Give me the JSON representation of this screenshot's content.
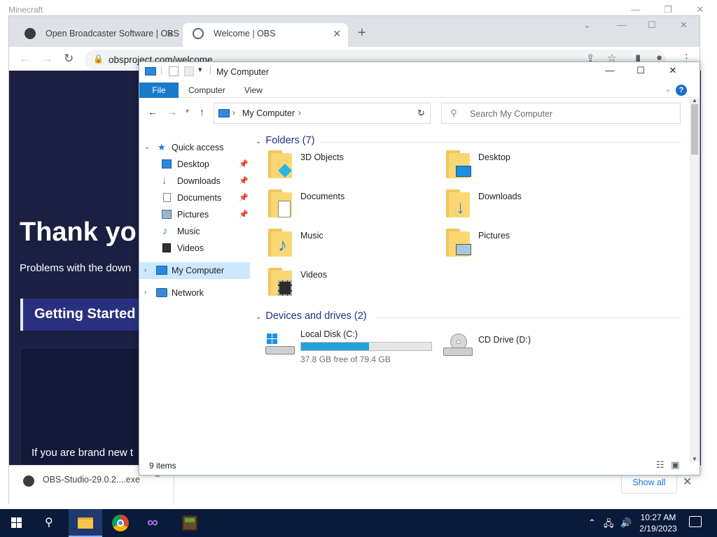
{
  "outer_window": {
    "title": "Minecraft"
  },
  "chrome": {
    "tabs": [
      {
        "label": "Open Broadcaster Software | OBS",
        "active": false
      },
      {
        "label": "Welcome | OBS",
        "active": true
      }
    ],
    "new_tab": "+",
    "url": "obsproject.com/welcome",
    "page": {
      "hero": "Thank yo",
      "subtitle": "Problems with the down",
      "getting_started": "Getting Started",
      "new_text": "If you are brand new t"
    },
    "download_bar": {
      "filename": "OBS-Studio-29.0.2....exe",
      "show_all": "Show all"
    }
  },
  "explorer": {
    "title": "My Computer",
    "ribbon_tabs": [
      "File",
      "Computer",
      "View"
    ],
    "address_crumb": "My Computer",
    "search_placeholder": "Search My Computer",
    "nav": [
      {
        "label": "Quick access",
        "level": 0,
        "expanded": true,
        "icon": "star-icon"
      },
      {
        "label": "Desktop",
        "level": 1,
        "pinned": true,
        "icon": "desktop-icon"
      },
      {
        "label": "Downloads",
        "level": 1,
        "pinned": true,
        "icon": "download-icon"
      },
      {
        "label": "Documents",
        "level": 1,
        "pinned": true,
        "icon": "document-icon"
      },
      {
        "label": "Pictures",
        "level": 1,
        "pinned": true,
        "icon": "picture-icon"
      },
      {
        "label": "Music",
        "level": 1,
        "pinned": false,
        "icon": "music-icon"
      },
      {
        "label": "Videos",
        "level": 1,
        "pinned": false,
        "icon": "video-icon"
      },
      {
        "label": "My Computer",
        "level": 0,
        "selected": true,
        "icon": "computer-icon"
      },
      {
        "label": "Network",
        "level": 0,
        "icon": "network-icon"
      }
    ],
    "folders_group": "Folders (7)",
    "folders": [
      {
        "name": "3D Objects",
        "icon": "cube-icon"
      },
      {
        "name": "Desktop",
        "icon": "desktop-icon"
      },
      {
        "name": "Documents",
        "icon": "document-icon"
      },
      {
        "name": "Downloads",
        "icon": "download-icon"
      },
      {
        "name": "Music",
        "icon": "music-icon"
      },
      {
        "name": "Pictures",
        "icon": "picture-icon"
      },
      {
        "name": "Videos",
        "icon": "video-icon"
      }
    ],
    "drives_group": "Devices and drives (2)",
    "drives": [
      {
        "name": "Local Disk (C:)",
        "free_text": "37.8 GB free of 79.4 GB",
        "used_fraction": 0.52,
        "icon": "hdd-windows-icon"
      },
      {
        "name": "CD Drive (D:)",
        "icon": "cd-drive-icon"
      }
    ],
    "status": "9 items"
  },
  "taskbar": {
    "clock_time": "10:27 AM",
    "clock_date": "2/19/2023"
  },
  "colors": {
    "accent_blue": "#1979ca",
    "page_bg": "#1b1f42",
    "taskbar": "#0a1a3a",
    "selection": "#cce8ff"
  }
}
